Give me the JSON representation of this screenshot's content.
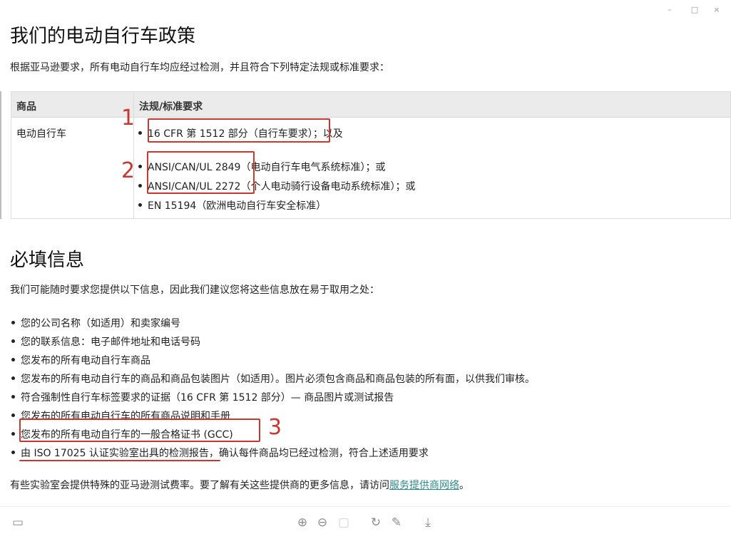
{
  "window": {
    "minimize": "–",
    "maximize": "□",
    "close": "×"
  },
  "policy": {
    "title": "我们的电动自行车政策",
    "intro": "根据亚马逊要求，所有电动自行车均应经过检测，并且符合下列特定法规或标准要求：",
    "table": {
      "headers": [
        "商品",
        "法规/标准要求"
      ],
      "product": "电动自行车",
      "items": [
        {
          "code": "16 CFR 第 1512 部分（自行车要求）",
          "suffix": "；以及"
        },
        {
          "code": "ANSI/CAN/UL 2849",
          "suffix": "（电动自行车电气系统标准）；或"
        },
        {
          "code": "ANSI/CAN/UL 2272",
          "suffix": "（个人电动骑行设备电动系统标准）；或"
        },
        {
          "code": "EN 15194",
          "suffix": "（欧洲电动自行车安全标准）"
        }
      ]
    }
  },
  "required": {
    "title": "必填信息",
    "intro": "我们可能随时要求您提供以下信息，因此我们建议您将这些信息放在易于取用之处：",
    "items": [
      "您的公司名称（如适用）和卖家编号",
      "您的联系信息：电子邮件地址和电话号码",
      "您发布的所有电动自行车商品",
      "您发布的所有电动自行车的商品和商品包装图片（如适用）。图片必须包含商品和商品包装的所有面，以供我们审核。",
      "符合强制性自行车标签要求的证据（16 CFR 第 1512 部分）— 商品图片或测试报告",
      "您发布的所有电动自行车的所有商品说明和手册",
      "您发布的所有电动自行车的一般合格证书 (GCC)",
      "由 ISO 17025 认证实验室出具的检测报告，确认每件商品均已经过检测，符合上述适用要求"
    ],
    "footer_prefix": "有些实验室会提供特殊的亚马逊测试费率。要了解有关这些提供商的更多信息，请访问",
    "footer_link": "服务提供商网络",
    "footer_suffix": "。"
  },
  "annotations": {
    "one": "1",
    "two": "2",
    "three": "3"
  },
  "toolbar": {
    "panel_icon": "▭",
    "zoom_in_icon": "⊕",
    "zoom_out_icon": "⊖",
    "fit_icon": "▢",
    "rotate_icon": "↻",
    "edit_icon": "✎",
    "download_icon": "⤓"
  }
}
